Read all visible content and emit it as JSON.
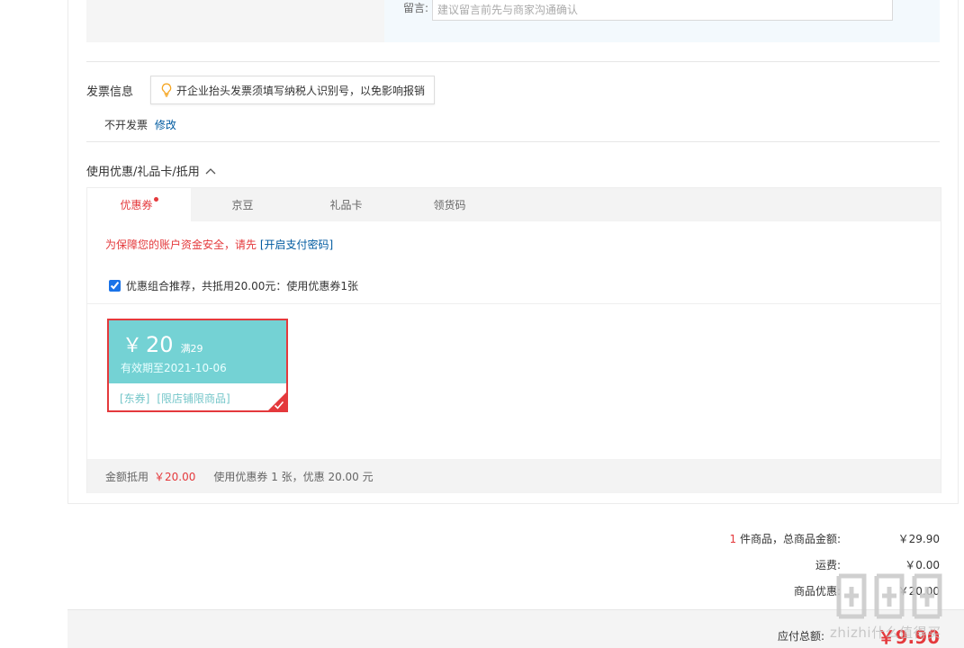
{
  "remark": {
    "label": "留言:",
    "placeholder": "建议留言前先与商家沟通确认"
  },
  "invoice": {
    "title": "发票信息",
    "tip": "开企业抬头发票须填写纳税人识别号，以免影响报销",
    "status": "不开发票",
    "edit_label": "修改"
  },
  "discounts": {
    "heading": "使用优惠/礼品卡/抵用",
    "tabs": [
      {
        "label": "优惠券",
        "active": true
      },
      {
        "label": "京豆",
        "active": false
      },
      {
        "label": "礼品卡",
        "active": false
      },
      {
        "label": "领货码",
        "active": false
      }
    ],
    "security_note": "为保障您的账户资金安全，请先",
    "security_link": "[开启支付密码]",
    "recommend_label": "优惠组合推荐，共抵用20.00元：使用优惠券1张",
    "recommend_checked": true,
    "coupon": {
      "currency": "￥",
      "amount": "20",
      "condition": "满29",
      "valid_until": "有效期至2021-10-06",
      "tags": [
        "[东券]",
        "[限店铺限商品]"
      ],
      "selected": true
    },
    "summary": {
      "label": "金额抵用",
      "amount": "￥20.00",
      "detail": "使用优惠券 1 张，优惠 20.00 元"
    }
  },
  "totals": {
    "item_count": "1",
    "item_suffix": "件商品，总商品金额:",
    "item_total": "￥29.90",
    "shipping_label": "运费:",
    "shipping": "￥0.00",
    "discount_label": "商品优惠:",
    "discount": "￥20.00",
    "payable_label": "应付总额:",
    "payable": "￥9.90"
  },
  "watermark": {
    "text": "zhizhi什么值得买"
  },
  "colors": {
    "accent_red": "#e4393c",
    "link_blue": "#005aa0",
    "coupon_teal": "#74d2d4"
  }
}
